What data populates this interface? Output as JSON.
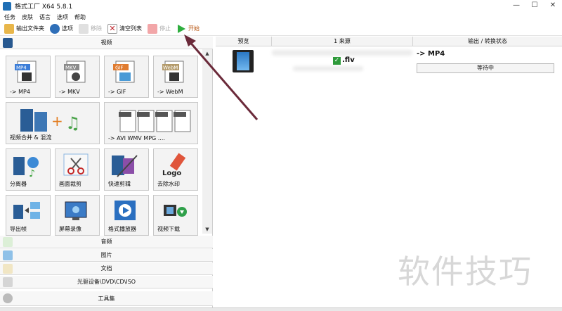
{
  "window": {
    "title": "格式工厂 X64 5.8.1",
    "minimize": "—",
    "maximize": "☐",
    "close": "✕"
  },
  "menu": [
    "任务",
    "皮肤",
    "语言",
    "选项",
    "帮助"
  ],
  "toolbar": {
    "output_folder": "输出文件夹",
    "options": "选项",
    "remove": "移除",
    "clear_list": "清空列表",
    "stop": "停止",
    "start": "开始"
  },
  "categories": {
    "video": "视频",
    "audio": "音频",
    "image": "图片",
    "document": "文档",
    "rom": "光驱设备\\DVD\\CD\\ISO",
    "tools": "工具集"
  },
  "tiles": [
    {
      "label": "-> MP4",
      "badge": "MP4"
    },
    {
      "label": "-> MKV",
      "badge": "MKV"
    },
    {
      "label": "-> GIF",
      "badge": "GIF"
    },
    {
      "label": "-> WebM",
      "badge": "WebM"
    },
    {
      "label": "视频合并 & 混流",
      "badge": ""
    },
    {
      "label": "-> AVI WMV MPG ....",
      "badge": ""
    },
    {
      "label": "分离器",
      "badge": ""
    },
    {
      "label": "画面裁剪",
      "badge": ""
    },
    {
      "label": "快速剪辑",
      "badge": ""
    },
    {
      "label": "去除水印",
      "badge": "Logo"
    },
    {
      "label": "导出帧",
      "badge": ""
    },
    {
      "label": "屏幕录像",
      "badge": ""
    },
    {
      "label": "格式播放器",
      "badge": ""
    },
    {
      "label": "视频下载",
      "badge": ""
    }
  ],
  "table": {
    "headers": [
      "预览",
      "1 来源",
      "输出 / 转换状态"
    ],
    "row": {
      "source_file": ".flv",
      "output_format": "-> MP4",
      "status": "等待中"
    }
  },
  "watermark": "软件技巧",
  "colors": {
    "arrow": "#6b2a3a",
    "start_green": "#2fae3f",
    "check_green": "#2e9a3a"
  }
}
